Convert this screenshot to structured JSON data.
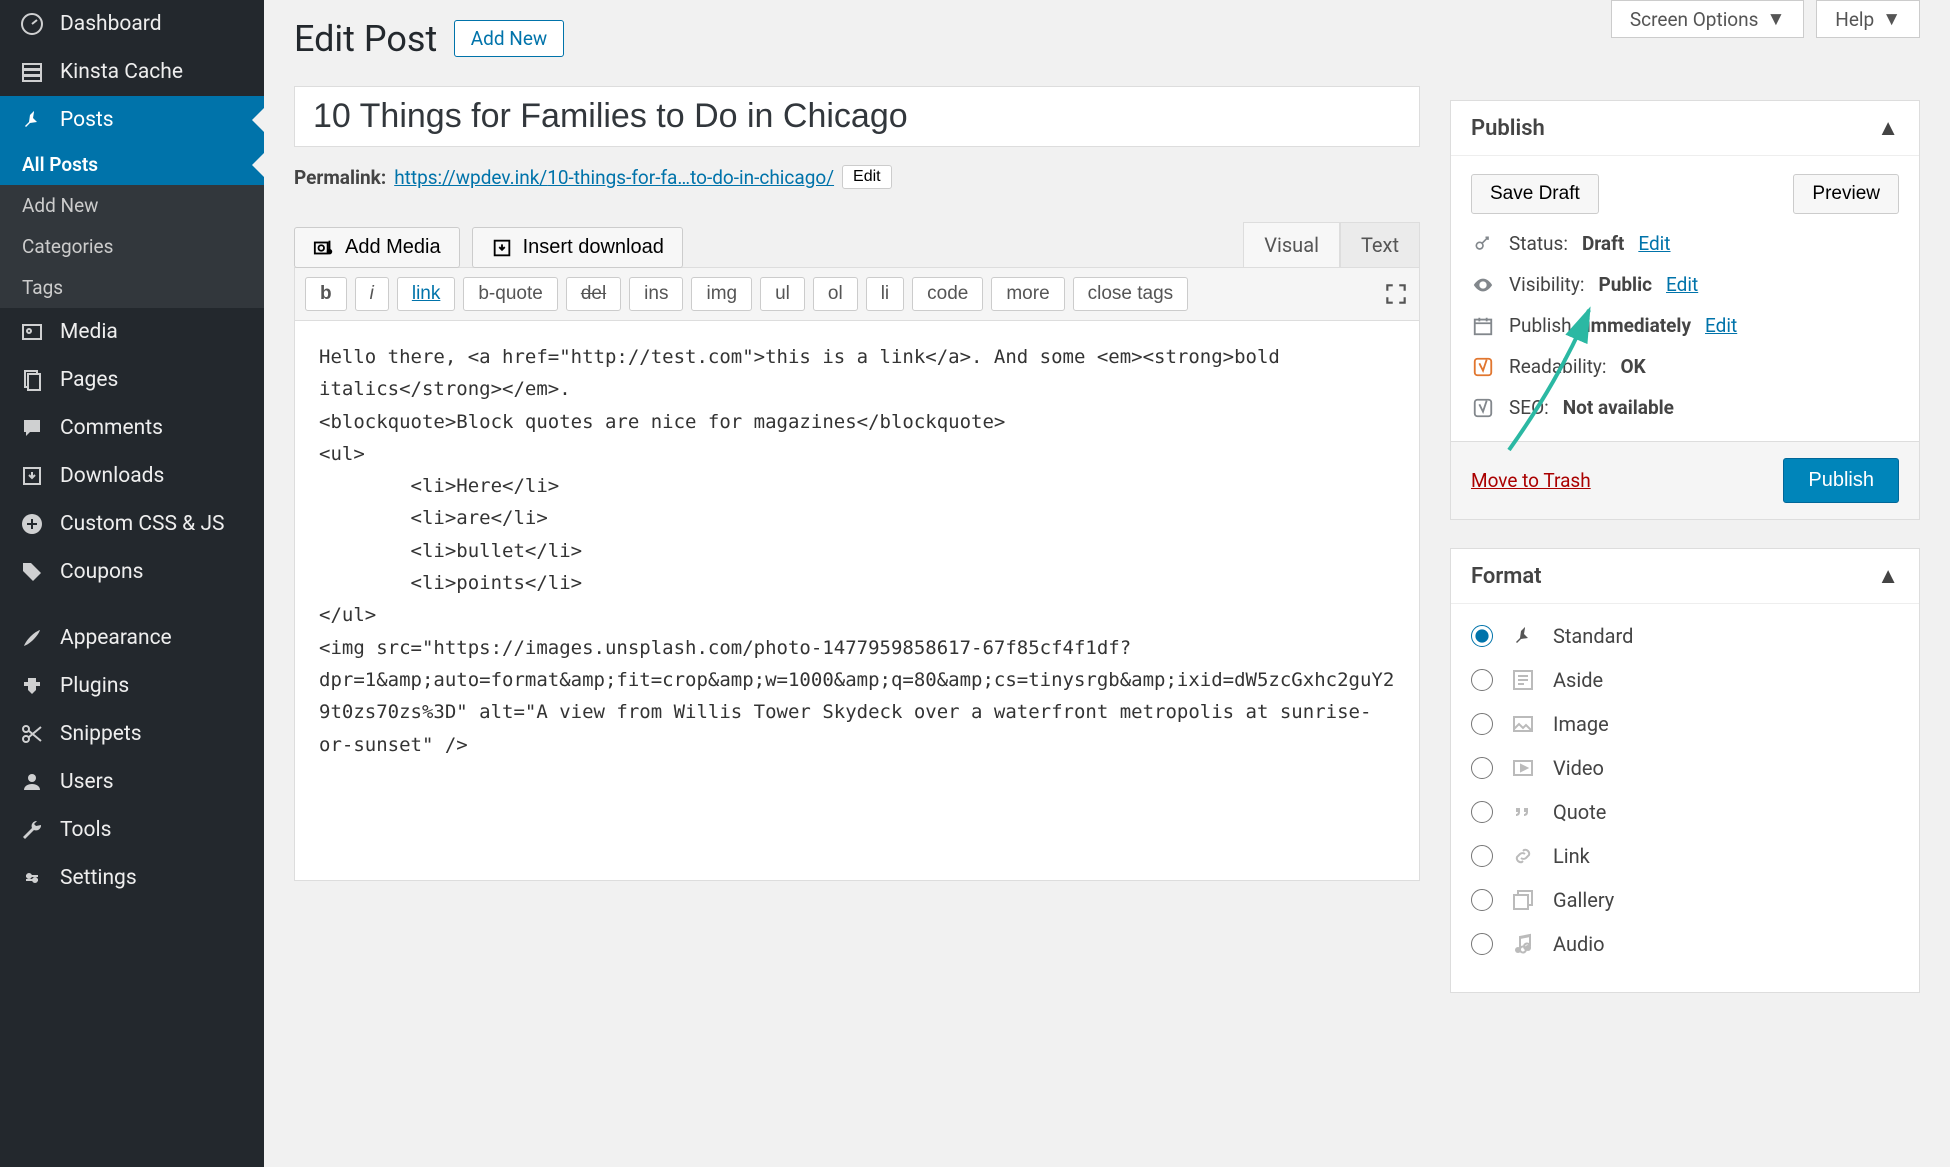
{
  "topbar": {
    "screen_options": "Screen Options",
    "help": "Help"
  },
  "sidebar": {
    "dashboard": "Dashboard",
    "kinsta": "Kinsta Cache",
    "posts": "Posts",
    "all_posts": "All Posts",
    "add_new": "Add New",
    "categories": "Categories",
    "tags": "Tags",
    "media": "Media",
    "pages": "Pages",
    "comments": "Comments",
    "downloads": "Downloads",
    "custom_css": "Custom CSS & JS",
    "coupons": "Coupons",
    "appearance": "Appearance",
    "plugins": "Plugins",
    "snippets": "Snippets",
    "users": "Users",
    "tools": "Tools",
    "settings": "Settings"
  },
  "header": {
    "title": "Edit Post",
    "add_new": "Add New"
  },
  "post": {
    "title": "10 Things for Families to Do in Chicago",
    "permalink_label": "Permalink:",
    "permalink_base": "https://wpdev.ink/",
    "permalink_slug": "10-things-for-fa…to-do-in-chicago/",
    "edit": "Edit"
  },
  "media": {
    "add_media": "Add Media",
    "insert_download": "Insert download"
  },
  "editor_tabs": {
    "visual": "Visual",
    "text": "Text"
  },
  "qtags": {
    "b": "b",
    "i": "i",
    "link": "link",
    "bquote": "b-quote",
    "del": "del",
    "ins": "ins",
    "img": "img",
    "ul": "ul",
    "ol": "ol",
    "li": "li",
    "code": "code",
    "more": "more",
    "close": "close tags"
  },
  "editor_content": "Hello there, <a href=\"http://test.com\">this is a link</a>. And some <em><strong>bold italics</strong></em>.\n<blockquote>Block quotes are nice for magazines</blockquote>\n<ul>\n \t<li>Here</li>\n \t<li>are</li>\n \t<li>bullet</li>\n \t<li>points</li>\n</ul>\n<img src=\"https://images.unsplash.com/photo-1477959858617-67f85cf4f1df?dpr=1&amp;auto=format&amp;fit=crop&amp;w=1000&amp;q=80&amp;cs=tinysrgb&amp;ixid=dW5zcGxhc2guY29t0zs70zs%3D\" alt=\"A view from Willis Tower Skydeck over a waterfront metropolis at sunrise-or-sunset\" />",
  "publish": {
    "heading": "Publish",
    "save_draft": "Save Draft",
    "preview": "Preview",
    "status_label": "Status:",
    "status_value": "Draft",
    "visibility_label": "Visibility:",
    "visibility_value": "Public",
    "publish_label": "Publish",
    "publish_value": "immediately",
    "readability_label": "Readability:",
    "readability_value": "OK",
    "seo_label": "SEO:",
    "seo_value": "Not available",
    "edit": "Edit",
    "trash": "Move to Trash",
    "publish_btn": "Publish"
  },
  "format": {
    "heading": "Format",
    "options": {
      "standard": "Standard",
      "aside": "Aside",
      "image": "Image",
      "video": "Video",
      "quote": "Quote",
      "link": "Link",
      "gallery": "Gallery",
      "audio": "Audio"
    }
  }
}
